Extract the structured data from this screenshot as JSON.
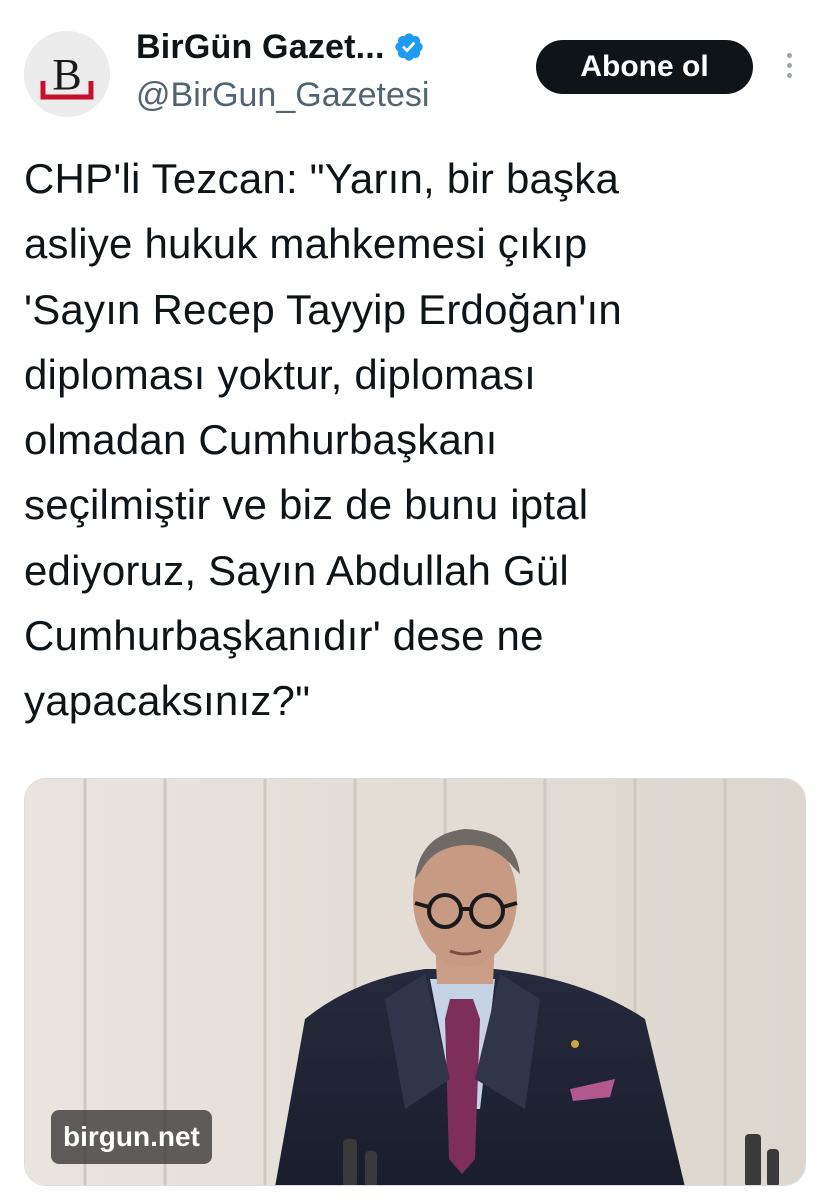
{
  "tweet": {
    "display_name": "BirGün Gazet...",
    "handle": "@BirGun_Gazetesi",
    "verified": true,
    "verified_icon": "verified-badge-icon",
    "avatar_letter": "B",
    "follow_label": "Abone ol",
    "more_icon": "more-vertical-icon",
    "text": "CHP'li Tezcan: \"Yarın, bir başka\nasliye hukuk mahkemesi çıkıp\n'Sayın Recep Tayyip Erdoğan'ın\ndiploması yoktur, diploması\nolmadan Cumhurbaşkanı\nseçilmiştir ve biz de bunu iptal\nediyoruz, Sayın Abdullah Gül\nCumhurbaşkanıdır' dese ne\nyapacaksınız?\"",
    "media": {
      "source_label": "birgun.net"
    }
  },
  "colors": {
    "accent_verified": "#1d9bf0",
    "button_bg": "#0f1419",
    "muted_text": "#536471",
    "avatar_brand": "#c8102e"
  }
}
